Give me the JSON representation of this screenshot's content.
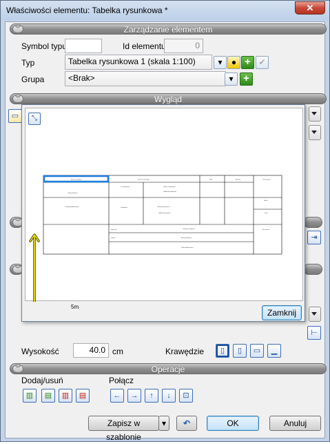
{
  "window": {
    "title": "Właściwości elementu: Tabelka rysunkowa *",
    "close_symbol": "✕"
  },
  "sections": {
    "management": "Zarządzanie elementem",
    "appearance": "Wygląd",
    "operations": "Operacje"
  },
  "management": {
    "symbol_label": "Symbol typu",
    "symbol_value": "",
    "id_label": "Id elementu",
    "id_value": "0",
    "type_label": "Typ",
    "type_value": "Tabelka rysunkowa 1 (skala 1:100)",
    "group_label": "Grupa",
    "group_value": "<Brak>"
  },
  "preview": {
    "scale_label": "5m",
    "close_button": "Zamknij",
    "table_cells": [
      "Nazwa projektu",
      "Nazwa inwestycji",
      "Etap",
      "Branża",
      "Nr rysunku",
      "<NazwaFirmy>",
      "Zr. projektant",
      "<Biuro Projektów>",
      "<AdresProjektanta>",
      "Skala",
      "Projektant",
      "<NazwaInwestora>",
      "<AdresInwestycji>",
      "<ProjektantArchitekt>",
      "Data",
      "Rysunek",
      "<Nazwa Projektu>",
      "Obiekt",
      "<NazwaObiektu>",
      "Nr arkusza",
      "<NazwaRysunku>"
    ]
  },
  "appearance": {
    "height_label": "Wysokość",
    "height_value": "40.0",
    "height_unit": "cm",
    "edges_label": "Krawędzie"
  },
  "operations": {
    "add_remove_label": "Dodaj/usuń",
    "join_label": "Połącz"
  },
  "footer": {
    "save_template": "Zapisz w szablonie",
    "ok": "OK",
    "cancel": "Anuluj"
  },
  "colors": {
    "accent": "#3c7fb1",
    "axis_yellow": "#f2e600",
    "selection_blue": "#1e7be0"
  }
}
